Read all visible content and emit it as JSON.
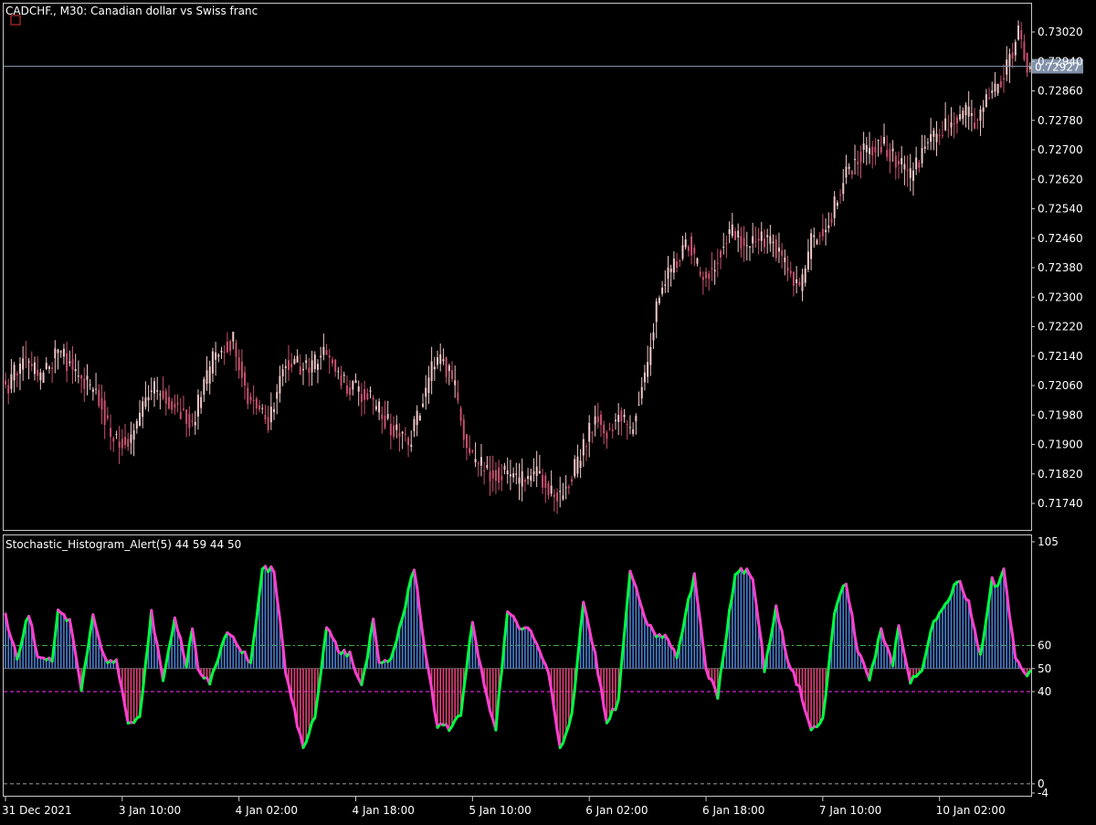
{
  "colors": {
    "background": "#000000",
    "frame": "#C8C8C8",
    "candle": "#C8506E",
    "candle_light": "#F0C8C8",
    "price_line": "#8090A8",
    "price_label_bg": "#8090A8",
    "hist_up": "#4A7FD0",
    "hist_down": "#E0407A",
    "line_up": "#00FF40",
    "line_down": "#FF40D0",
    "level_upper": "#3CB43C",
    "level_lower": "#FF30FF",
    "level_zero": "#A0A0A0"
  },
  "main_title": "CADCHF., M30:  Canadian dollar vs Swiss franc",
  "indicator_title": "Stochastic_Histogram_Alert(5) 44 59 44 50",
  "current_price": "0.72927",
  "chart_data": [
    {
      "type": "candlestick",
      "title": "CADCHF., M30:  Canadian dollar vs Swiss franc",
      "ylim": [
        0.7168,
        0.7306
      ],
      "y_ticks": [
        "0.73020",
        "0.72940",
        "0.72860",
        "0.72780",
        "0.72700",
        "0.72620",
        "0.72540",
        "0.72460",
        "0.72380",
        "0.72300",
        "0.72220",
        "0.72140",
        "0.72060",
        "0.71980",
        "0.71900",
        "0.71820",
        "0.71740"
      ],
      "x_ticks": [
        "31 Dec 2021",
        "3 Jan 10:00",
        "4 Jan 02:00",
        "4 Jan 18:00",
        "5 Jan 10:00",
        "6 Jan 02:00",
        "6 Jan 18:00",
        "7 Jan 10:00",
        "10 Jan 02:00"
      ],
      "close_anchors": [
        [
          0,
          0.7205
        ],
        [
          6,
          0.7213
        ],
        [
          12,
          0.7208
        ],
        [
          18,
          0.7215
        ],
        [
          24,
          0.721
        ],
        [
          32,
          0.7203
        ],
        [
          36,
          0.7193
        ],
        [
          42,
          0.719
        ],
        [
          50,
          0.7205
        ],
        [
          56,
          0.7202
        ],
        [
          64,
          0.7196
        ],
        [
          72,
          0.7215
        ],
        [
          78,
          0.7218
        ],
        [
          82,
          0.7205
        ],
        [
          90,
          0.7195
        ],
        [
          96,
          0.7213
        ],
        [
          104,
          0.721
        ],
        [
          110,
          0.7215
        ],
        [
          116,
          0.7207
        ],
        [
          124,
          0.7203
        ],
        [
          132,
          0.7195
        ],
        [
          138,
          0.719
        ],
        [
          146,
          0.721
        ],
        [
          150,
          0.7213
        ],
        [
          154,
          0.7205
        ],
        [
          158,
          0.7188
        ],
        [
          164,
          0.7183
        ],
        [
          170,
          0.7182
        ],
        [
          176,
          0.718
        ],
        [
          182,
          0.7183
        ],
        [
          186,
          0.7178
        ],
        [
          190,
          0.7176
        ],
        [
          196,
          0.7185
        ],
        [
          202,
          0.7198
        ],
        [
          206,
          0.7193
        ],
        [
          210,
          0.7198
        ],
        [
          214,
          0.7193
        ],
        [
          220,
          0.7213
        ],
        [
          224,
          0.7232
        ],
        [
          228,
          0.7238
        ],
        [
          234,
          0.7245
        ],
        [
          238,
          0.7236
        ],
        [
          242,
          0.7238
        ],
        [
          248,
          0.7248
        ],
        [
          254,
          0.7244
        ],
        [
          262,
          0.7246
        ],
        [
          268,
          0.7237
        ],
        [
          272,
          0.7232
        ],
        [
          276,
          0.7245
        ],
        [
          282,
          0.725
        ],
        [
          288,
          0.7264
        ],
        [
          294,
          0.727
        ],
        [
          300,
          0.7272
        ],
        [
          306,
          0.7266
        ],
        [
          310,
          0.7263
        ],
        [
          316,
          0.7272
        ],
        [
          322,
          0.7276
        ],
        [
          328,
          0.728
        ],
        [
          332,
          0.7278
        ],
        [
          336,
          0.7283
        ],
        [
          340,
          0.7288
        ],
        [
          344,
          0.7295
        ],
        [
          347,
          0.7301
        ],
        [
          350,
          0.7293
        ]
      ],
      "last_close": 0.72927
    },
    {
      "type": "histogram",
      "title": "Stochastic_Histogram_Alert(5) 44 59 44 50",
      "ylim": [
        -4,
        105
      ],
      "y_ticks": [
        "105",
        "60",
        "50",
        "40",
        "0",
        "-4"
      ],
      "levels": [
        60,
        50,
        40,
        0
      ],
      "baseline": 50,
      "k_anchors": [
        [
          0,
          73
        ],
        [
          4,
          54
        ],
        [
          8,
          74
        ],
        [
          11,
          54
        ],
        [
          16,
          53
        ],
        [
          18,
          74
        ],
        [
          22,
          71
        ],
        [
          26,
          42
        ],
        [
          30,
          73
        ],
        [
          34,
          54
        ],
        [
          38,
          53
        ],
        [
          42,
          25
        ],
        [
          46,
          30
        ],
        [
          50,
          74
        ],
        [
          54,
          44
        ],
        [
          58,
          73
        ],
        [
          62,
          52
        ],
        [
          64,
          68
        ],
        [
          66,
          50
        ],
        [
          70,
          43
        ],
        [
          76,
          66
        ],
        [
          80,
          60
        ],
        [
          84,
          52
        ],
        [
          88,
          93
        ],
        [
          92,
          93
        ],
        [
          96,
          48
        ],
        [
          102,
          15
        ],
        [
          106,
          30
        ],
        [
          110,
          68
        ],
        [
          114,
          58
        ],
        [
          118,
          56
        ],
        [
          122,
          42
        ],
        [
          126,
          70
        ],
        [
          128,
          52
        ],
        [
          132,
          54
        ],
        [
          136,
          72
        ],
        [
          140,
          94
        ],
        [
          144,
          56
        ],
        [
          148,
          25
        ],
        [
          152,
          24
        ],
        [
          156,
          31
        ],
        [
          160,
          70
        ],
        [
          164,
          42
        ],
        [
          168,
          24
        ],
        [
          172,
          75
        ],
        [
          176,
          68
        ],
        [
          180,
          66
        ],
        [
          186,
          48
        ],
        [
          190,
          15
        ],
        [
          194,
          30
        ],
        [
          198,
          79
        ],
        [
          202,
          56
        ],
        [
          206,
          26
        ],
        [
          210,
          36
        ],
        [
          214,
          93
        ],
        [
          218,
          75
        ],
        [
          222,
          65
        ],
        [
          226,
          64
        ],
        [
          230,
          55
        ],
        [
          236,
          91
        ],
        [
          240,
          50
        ],
        [
          244,
          38
        ],
        [
          250,
          92
        ],
        [
          254,
          93
        ],
        [
          256,
          90
        ],
        [
          260,
          50
        ],
        [
          264,
          76
        ],
        [
          268,
          54
        ],
        [
          272,
          41
        ],
        [
          276,
          23
        ],
        [
          280,
          28
        ],
        [
          284,
          74
        ],
        [
          288,
          88
        ],
        [
          292,
          57
        ],
        [
          296,
          46
        ],
        [
          300,
          66
        ],
        [
          304,
          52
        ],
        [
          306,
          70
        ],
        [
          310,
          44
        ],
        [
          314,
          50
        ],
        [
          318,
          70
        ],
        [
          322,
          77
        ],
        [
          326,
          89
        ],
        [
          330,
          79
        ],
        [
          334,
          55
        ],
        [
          338,
          89
        ],
        [
          340,
          85
        ],
        [
          342,
          93
        ],
        [
          346,
          54
        ],
        [
          349,
          48
        ]
      ]
    }
  ]
}
